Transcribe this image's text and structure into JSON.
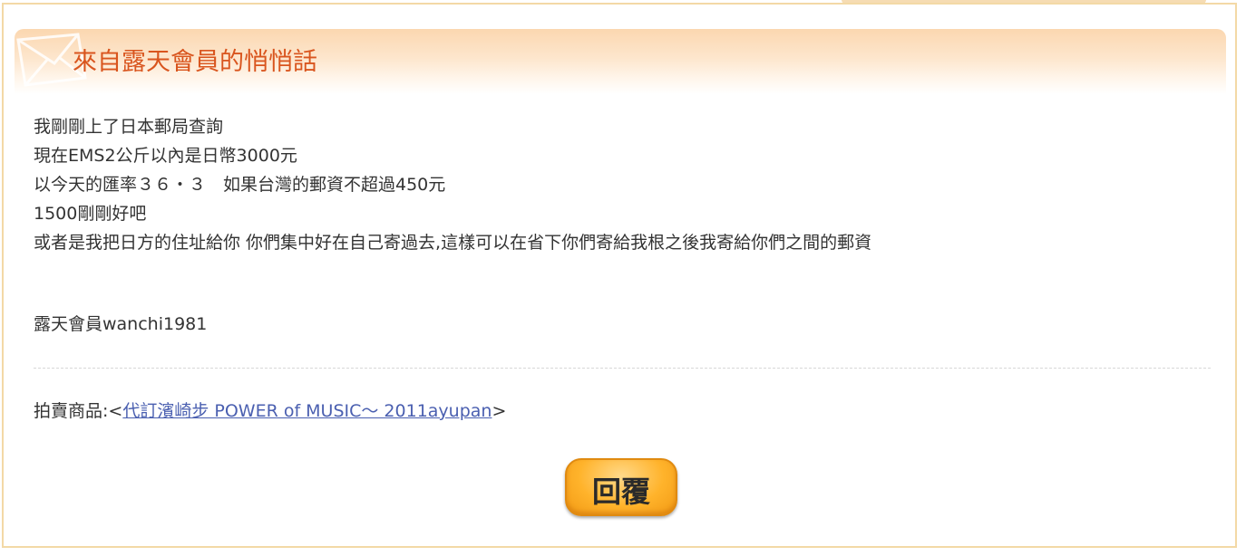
{
  "header": {
    "title": "來自露天會員的悄悄話",
    "icon": "envelope-icon"
  },
  "message": {
    "lines": [
      "我剛剛上了日本郵局查詢",
      "現在EMS2公斤以內是日幣3000元",
      "以今天的匯率３６・３　如果台灣的郵資不超過450元",
      "1500剛剛好吧",
      "或者是我把日方的住址給你 你們集中好在自己寄過去,這樣可以在省下你們寄給我根之後我寄給你們之間的郵資"
    ]
  },
  "signature": "露天會員wanchi1981",
  "product": {
    "prefix": "拍賣商品:<",
    "link_text": "代訂濱崎步 POWER of MUSIC～ 2011ayupan",
    "suffix": ">"
  },
  "reply_button": {
    "label": "回覆"
  },
  "colors": {
    "title": "#d9551e",
    "border": "#f3d9a6",
    "link": "#4a5fb0",
    "button": "#ffb32b"
  }
}
